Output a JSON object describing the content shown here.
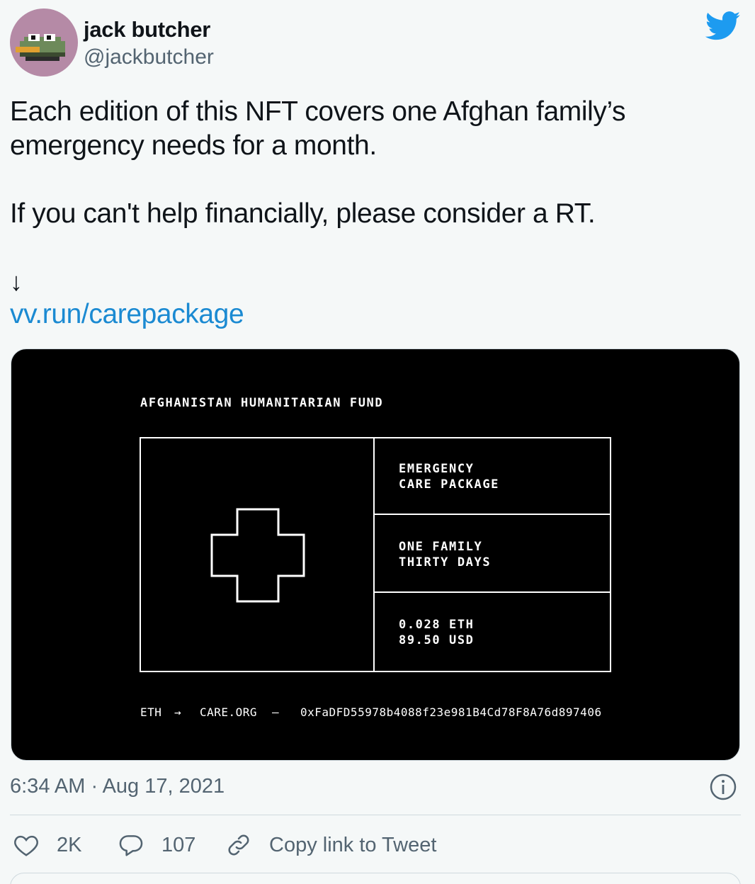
{
  "author": {
    "name": "jack butcher",
    "handle": "@jackbutcher",
    "avatar_icon": "pixel-frog-avatar",
    "avatar_bg": "#b58aa6"
  },
  "platform_icon": "twitter-bird-icon",
  "tweet": {
    "line1": "Each edition of this NFT covers one Afghan family’s",
    "line2": "emergency needs for a month.",
    "line3": "If you can't help financially, please consider a RT.",
    "arrow": "↓",
    "link": "vv.run/carepackage"
  },
  "card": {
    "title": "AFGHANISTAN HUMANITARIAN FUND",
    "cell1": [
      "EMERGENCY",
      "CARE PACKAGE"
    ],
    "cell2": [
      "ONE FAMILY",
      "THIRTY DAYS"
    ],
    "cell3": [
      "0.028 ETH",
      "89.50 USD"
    ],
    "footer": {
      "eth": "ETH",
      "arrow": "→",
      "org": "CARE.ORG",
      "dash": "—",
      "address": "0xFaDFD55978b4088f23e981B4Cd78F8A76d897406"
    }
  },
  "timestamp": "6:34 AM · Aug 17, 2021",
  "actions": {
    "likes": "2K",
    "replies": "107",
    "copy_link": "Copy link to Tweet"
  },
  "colors": {
    "link": "#1b8ad2",
    "twitter_blue": "#1d9bf0",
    "muted": "#536471",
    "background": "#f5f8f8"
  }
}
